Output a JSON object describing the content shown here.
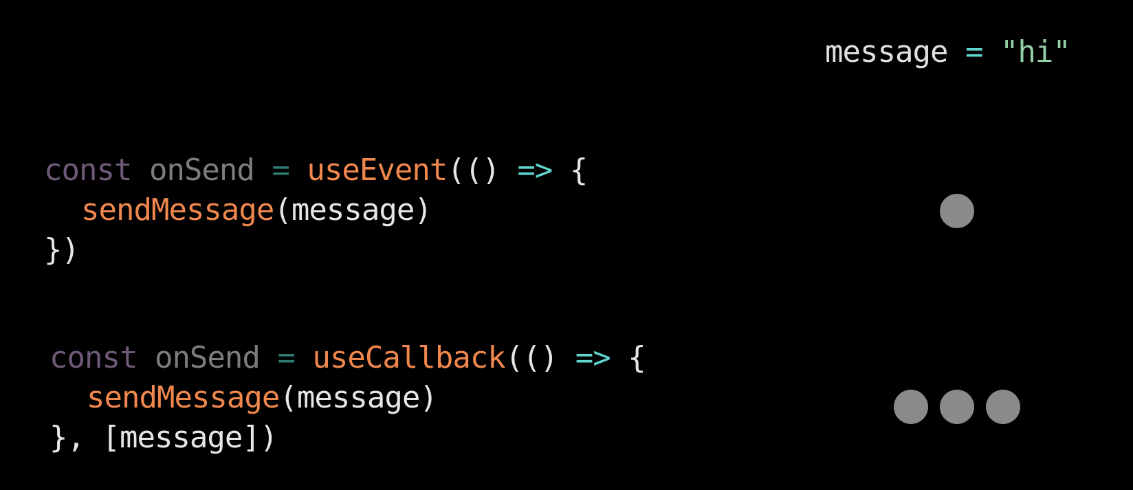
{
  "header": {
    "var_name": "message",
    "equals": "=",
    "value": "\"hi\""
  },
  "block_event": {
    "line1": {
      "kw": "const",
      "name": "onSend",
      "eq": "=",
      "fn": "useEvent",
      "open": "(()",
      "arrow": "=>",
      "brace": "{"
    },
    "line2": {
      "fn": "sendMessage",
      "args": "(message)"
    },
    "line3": {
      "close": "})"
    }
  },
  "block_callback": {
    "line1": {
      "kw": "const",
      "name": "onSend",
      "eq": "=",
      "fn": "useCallback",
      "open": "(()",
      "arrow": "=>",
      "brace": "{"
    },
    "line2": {
      "fn": "sendMessage",
      "args": "(message)"
    },
    "line3": {
      "close": "}, [message])"
    }
  },
  "indicators": {
    "event_dot_count": 1,
    "callback_dot_count": 3,
    "dot_color": "#8a8a8a"
  }
}
